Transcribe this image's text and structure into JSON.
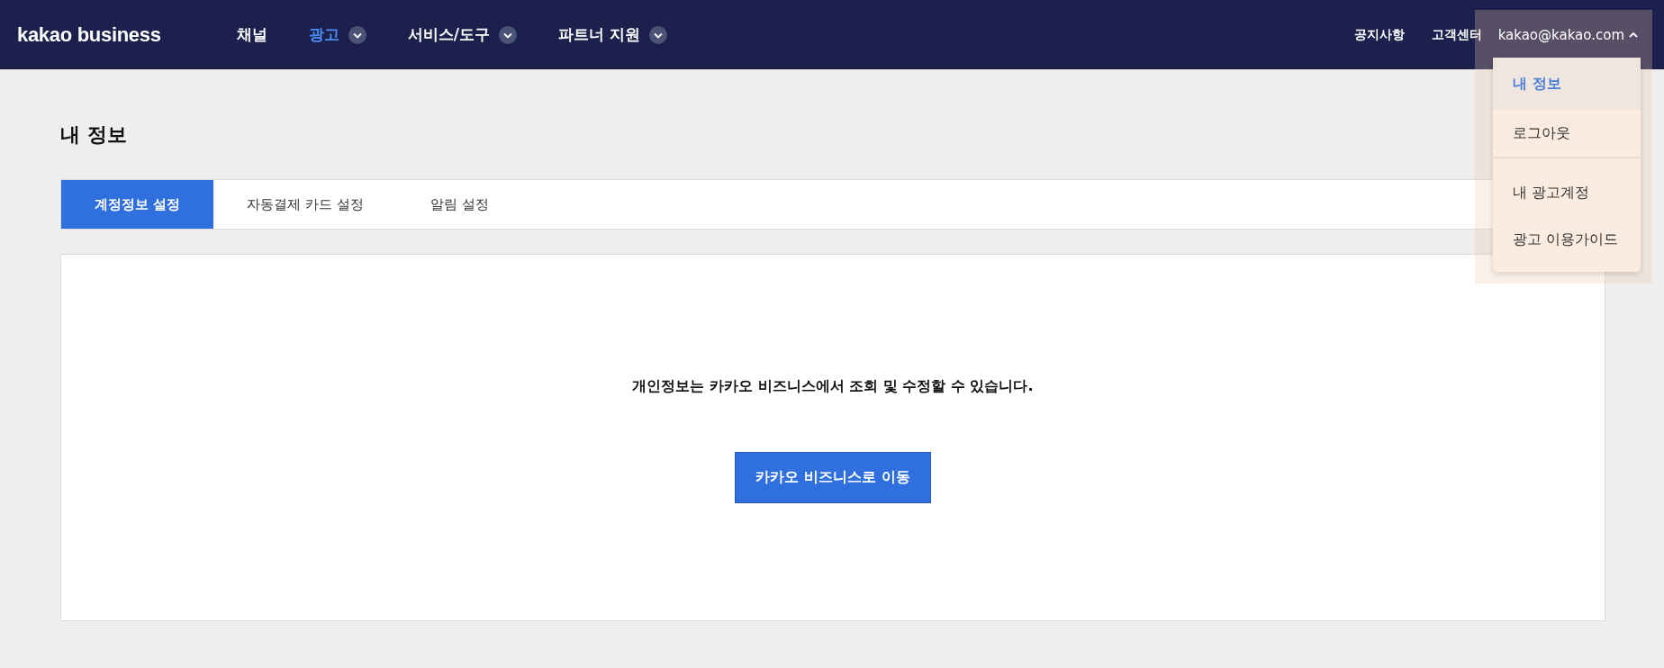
{
  "header": {
    "logo": "kakao business",
    "nav": [
      {
        "label": "채널",
        "selected": false,
        "dropdown": false
      },
      {
        "label": "광고",
        "selected": true,
        "dropdown": true
      },
      {
        "label": "서비스/도구",
        "selected": false,
        "dropdown": true
      },
      {
        "label": "파트너 지원",
        "selected": false,
        "dropdown": true
      }
    ],
    "links": [
      "공지사항",
      "고객센터"
    ],
    "account": {
      "email": "kakao@kakao.com",
      "expanded": true
    }
  },
  "account_menu": {
    "groups": [
      [
        {
          "label": "내 정보",
          "selected": true
        },
        {
          "label": "로그아웃",
          "selected": false
        }
      ],
      [
        {
          "label": "내 광고계정",
          "selected": false
        },
        {
          "label": "광고 이용가이드",
          "selected": false
        }
      ]
    ]
  },
  "page_title": "내 정보",
  "tabs": [
    {
      "label": "계정정보 설정",
      "selected": true
    },
    {
      "label": "자동결제 카드 설정",
      "selected": false
    },
    {
      "label": "알림 설정",
      "selected": false
    }
  ],
  "content": {
    "message": "개인정보는 카카오 비즈니스에서 조회 및 수정할 수 있습니다.",
    "button": "카카오 비즈니스로 이동"
  }
}
